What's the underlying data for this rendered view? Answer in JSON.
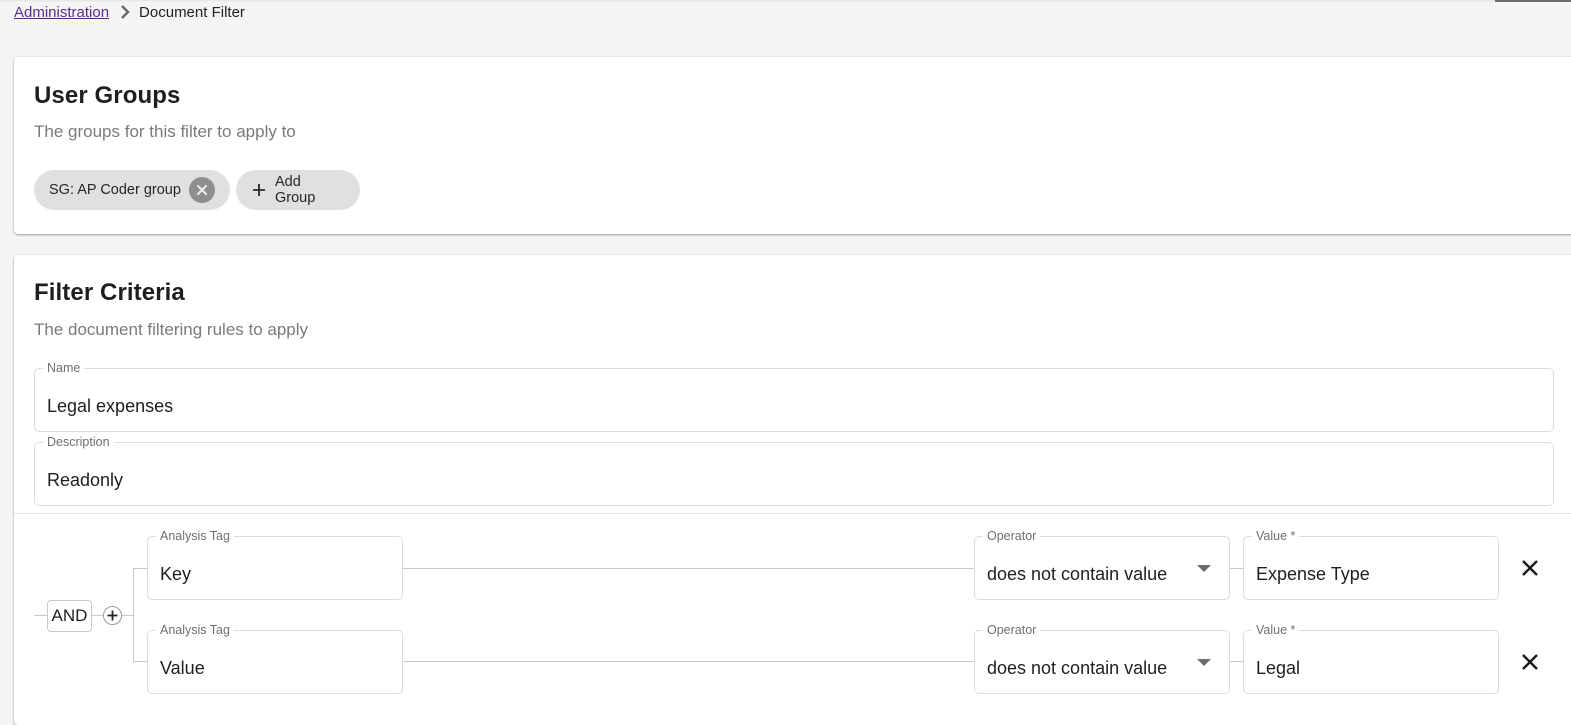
{
  "breadcrumb": {
    "parent": "Administration",
    "current": "Document Filter"
  },
  "user_groups": {
    "title": "User Groups",
    "subtitle": "The groups for this filter to apply to",
    "chips": [
      {
        "label": "SG: AP Coder group"
      }
    ],
    "add_label": "Add Group"
  },
  "filter_criteria": {
    "title": "Filter Criteria",
    "subtitle": "The document filtering rules to apply",
    "name": {
      "label": "Name",
      "value": "Legal expenses"
    },
    "description": {
      "label": "Description",
      "value": "Readonly"
    },
    "logic": "AND",
    "rules": [
      {
        "tag_label": "Analysis Tag",
        "tag_value": "Key",
        "operator_label": "Operator",
        "operator_value": "does not contain value",
        "value_label": "Value *",
        "value": "Expense Type"
      },
      {
        "tag_label": "Analysis Tag",
        "tag_value": "Value",
        "operator_label": "Operator",
        "operator_value": "does not contain value",
        "value_label": "Value *",
        "value": "Legal"
      }
    ]
  },
  "colors": {
    "link": "#5b2d86",
    "chip_bg": "#e0e0e0",
    "page_bg": "#f4f4f4"
  }
}
